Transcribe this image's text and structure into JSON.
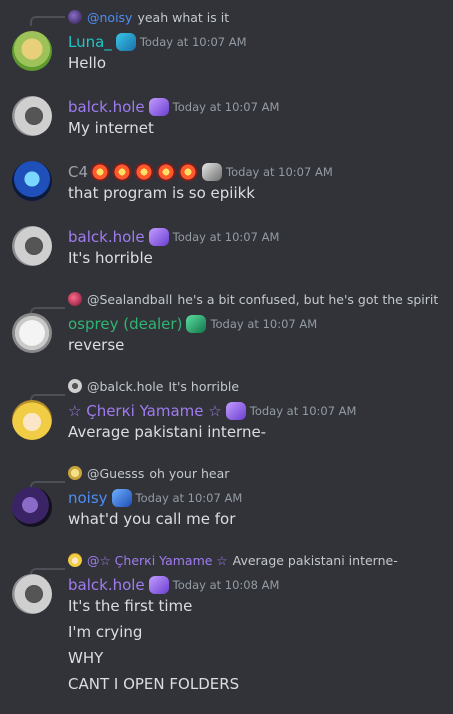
{
  "colors": {
    "background": "#313338",
    "text": "#dbdee1",
    "timestamp": "#949ba4",
    "reply_text": "#c4c9ce",
    "luna": "#1fc7c7",
    "purple": "#a07cf0",
    "c4": "#9da3ab",
    "osprey": "#2fb574",
    "noisy": "#4d8ef5"
  },
  "messages": [
    {
      "reply": {
        "user": "@noisy",
        "text": "yeah what is it"
      },
      "username": "Luna_",
      "timestamp": "Today at 10:07 AM",
      "lines": [
        "Hello"
      ]
    },
    {
      "username": "balck.hole",
      "timestamp": "Today at 10:07 AM",
      "lines": [
        "My internet"
      ]
    },
    {
      "username": "C4",
      "timestamp": "Today at 10:07 AM",
      "lines": [
        "that program is so epiikk"
      ]
    },
    {
      "username": "balck.hole",
      "timestamp": "Today at 10:07 AM",
      "lines": [
        "It's horrible"
      ]
    },
    {
      "reply": {
        "user": "@Sealandball",
        "text": "he's a bit confused, but he's got the spirit"
      },
      "username": "osprey (dealer)",
      "timestamp": "Today at 10:07 AM",
      "lines": [
        "reverse"
      ]
    },
    {
      "reply": {
        "user": "@balck.hole",
        "text": "It's horrible"
      },
      "username": "☆ Çherкі Yamame ☆",
      "timestamp": "Today at 10:07 AM",
      "lines": [
        "Average pakistani interne-"
      ]
    },
    {
      "reply": {
        "user": "@Guesss",
        "text": "oh your hear"
      },
      "username": "noisy",
      "timestamp": "Today at 10:07 AM",
      "lines": [
        "what'd you call me for"
      ]
    },
    {
      "reply": {
        "user": "@☆ Çherкі Yamame ☆",
        "text": "Average pakistani interne-"
      },
      "username": "balck.hole",
      "timestamp": "Today at 10:08 AM",
      "lines": [
        "It's the first time",
        "I'm crying",
        "WHY",
        "CANT I OPEN FOLDERS"
      ]
    }
  ]
}
